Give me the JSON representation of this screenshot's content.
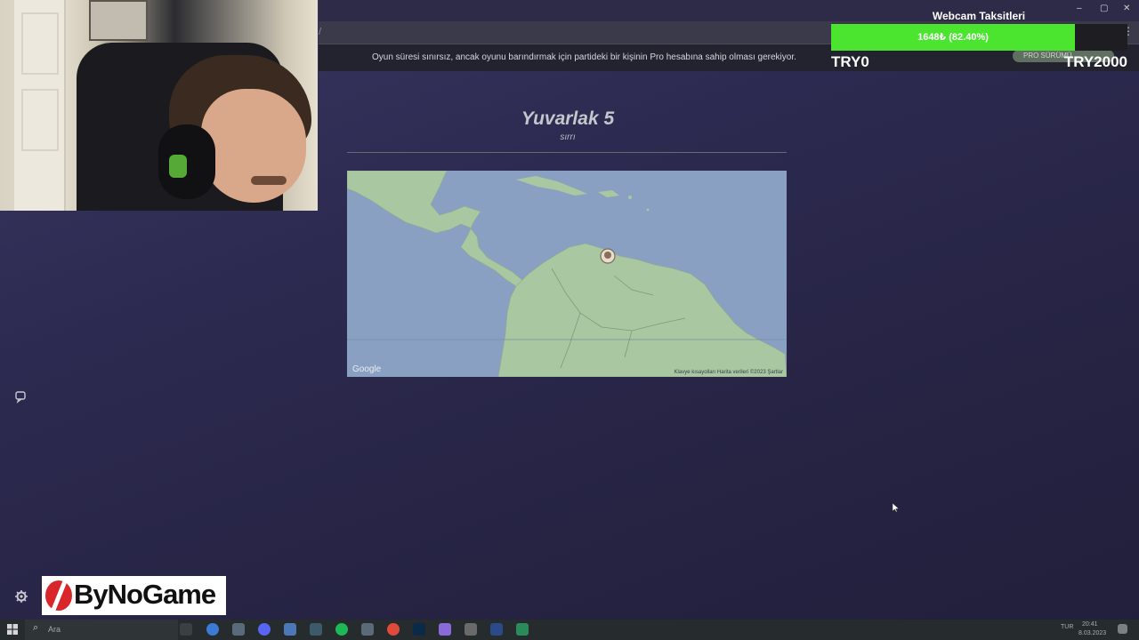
{
  "browser": {
    "address_glyph": "/",
    "address_right_glyph": "⋮",
    "notice": "Oyun süresi sınırsız, ancak oyunu barındırmak için partideki bir kişinin Pro hesabına sahip olması gerekiyor.",
    "pro_pill_label": "PRO SÜRÜMÜ"
  },
  "webcam_goal": {
    "title": "Webcam Taksitleri",
    "progress_label": "1648₺ (82.40%)",
    "progress_fraction": 0.824,
    "min_label": "TRY0",
    "max_label": "TRY2000",
    "fill_color": "#4be52f"
  },
  "window_controls": {
    "minimize": "–",
    "maximize": "▢",
    "close": "✕"
  },
  "round": {
    "title": "Yuvarlak 5",
    "subtitle": "sırrı"
  },
  "map": {
    "provider_label": "Google",
    "attribution": "Klavye kısayolları   Harita verileri ©2023   Şartlar",
    "water_color": "#8aa0c2",
    "land_color": "#a9c7a0"
  },
  "left_icons": {
    "chat": "chat-icon",
    "settings": "gear-icon"
  },
  "logo": {
    "text": "ByNoGame"
  },
  "taskbar": {
    "search_placeholder": "Ara",
    "tray_lang": "TUR",
    "clock_time": "20:41",
    "clock_date": "8.03.2023"
  }
}
